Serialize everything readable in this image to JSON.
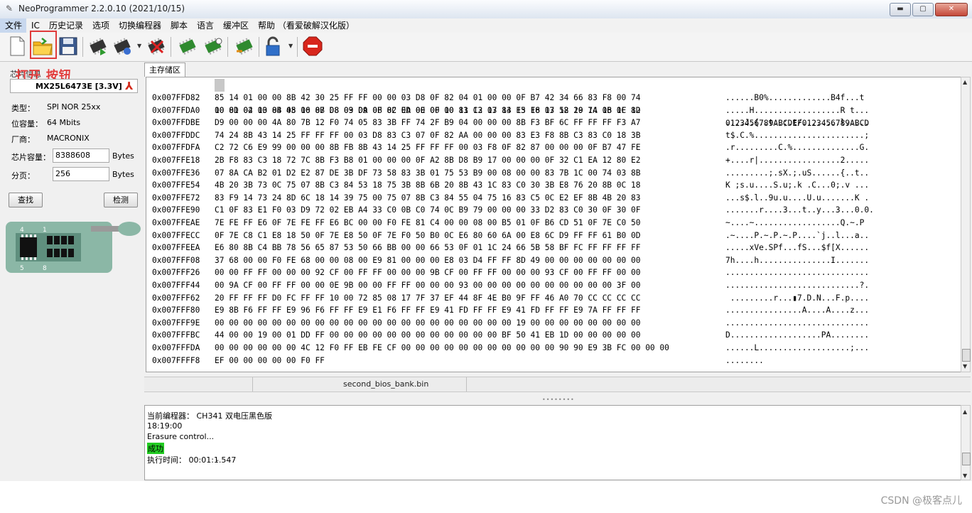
{
  "window": {
    "title": "NeoProgrammer 2.2.0.10 (2021/10/15)"
  },
  "menu": [
    "文件",
    "IC",
    "历史记录",
    "选项",
    "切换编程器",
    "脚本",
    "语言",
    "缓冲区",
    "帮助 （看爱破解汉化版）"
  ],
  "toolbar": {
    "icons": [
      "new-file-icon",
      "open-folder-icon",
      "save-disk-icon",
      "read-chip-icon",
      "write-chip-icon",
      "erase-chip-icon",
      "verify-chip-icon",
      "blank-check-icon",
      "auto-chip-icon",
      "lock-icon",
      "stop-icon"
    ]
  },
  "annotation": "打开 按钮",
  "chip_info": {
    "group_label": "芯片信息",
    "chip_name": "MX25L6473E [3.3V]",
    "type_label": "类型：",
    "type_value": "SPI NOR 25xx",
    "bits_label": "位容量：",
    "bits_value": "64 Mbits",
    "vendor_label": "厂商：",
    "vendor_value": "MACRONIX",
    "capacity_label": "芯片容量：",
    "capacity_value": "8388608",
    "capacity_unit": "Bytes",
    "page_label": "分页：",
    "page_value": "256",
    "page_unit": "Bytes",
    "find_button": "查找",
    "detect_button": "检测",
    "pin_labels": [
      "4",
      "1",
      "5",
      "8"
    ]
  },
  "tab": {
    "label": "主存储区"
  },
  "hex": {
    "header": "00 01 02 03 04 05 06 07 08 09 0A 0B 0C 0D 0E 0F 10 11 12 13 14 15 16 17 18 19 1A 1B 1C 1D",
    "ascii_header": "0123456789ABCDEF0123456789ABCD",
    "rows": [
      {
        "addr": "0x007FFD82",
        "bytes": "85 14 01 00 00 8B 42 30 25 FF FF 00 00 03 D8 0F 82 04 01 00 00 0F B7 42 34 66 83 F8 00 74",
        "ascii": "......B0%.............B4f...t"
      },
      {
        "addr": "0x007FFDA0",
        "bytes": "10 8D 04 10 8B 48 10 8B D8 03 D9 0F 82 EA 00 00 00 83 C3 07 83 E3 F8 03 52 20 74 06 0F 82",
        "ascii": ".....H..................R t..."
      },
      {
        "addr": "0x007FFDBE",
        "bytes": "D9 00 00 00 4A 80 7B 12 F0 74 05 83 3B FF 74 2F B9 04 00 00 00 8B F3 BF 6C FF FF FF F3 A7",
        "ascii": "....J.{..t..;.t/........l....."
      },
      {
        "addr": "0x007FFDDC",
        "bytes": "74 24 8B 43 14 25 FF FF FF 00 03 D8 83 C3 07 0F 82 AA 00 00 00 83 E3 F8 8B C3 83 C0 18 3B",
        "ascii": "t$.C.%.......................;"
      },
      {
        "addr": "0x007FFDFA",
        "bytes": "C2 72 C6 E9 99 00 00 00 8B FB 8B 43 14 25 FF FF FF 00 03 F8 0F 82 87 00 00 00 0F B7 47 FE",
        "ascii": ".r.........C.%..............G."
      },
      {
        "addr": "0x007FFE18",
        "bytes": "2B F8 83 C3 18 72 7C 8B F3 B8 01 00 00 00 0F A2 8B D8 B9 17 00 00 00 0F 32 C1 EA 12 80 E2",
        "ascii": "+....r|.................2....."
      },
      {
        "addr": "0x007FFE36",
        "bytes": "07 8A CA B2 01 D2 E2 87 DE 3B DF 73 58 83 3B 01 75 53 B9 00 08 00 00 83 7B 1C 00 74 03 8B",
        "ascii": ".........;.sX.;.uS......{..t.."
      },
      {
        "addr": "0x007FFE54",
        "bytes": "4B 20 3B 73 0C 75 07 8B C3 84 53 18 75 3B 8B 6B 20 8B 43 1C 83 C0 30 3B E8 76 20 8B 0C 18",
        "ascii": "K ;s.u....S.u;.k .C...0;.v ..."
      },
      {
        "addr": "0x007FFE72",
        "bytes": "83 F9 14 73 24 8D 6C 18 14 39 75 00 75 07 8B C3 84 55 04 75 16 83 C5 0C E2 EF 8B 4B 20 83",
        "ascii": "...s$.l..9u.u....U.u.......K ."
      },
      {
        "addr": "0x007FFE90",
        "bytes": "C1 0F 83 E1 F0 03 D9 72 02 EB A4 33 C0 0B C0 74 0C B9 79 00 00 00 33 D2 83 C0 30 0F 30 0F",
        "ascii": ".......r....3...t..y...3...0.0."
      },
      {
        "addr": "0x007FFEAE",
        "bytes": "7E FE FF E6 0F 7E FE FF E6 BC 00 00 F0 FE 81 C4 00 00 08 00 B5 01 0F B6 CD 51 0F 7E C0 50",
        "ascii": "~....~..................Q.~.P"
      },
      {
        "addr": "0x007FFECC",
        "bytes": "0F 7E C8 C1 E8 18 50 0F 7E E8 50 0F 7E F0 50 B0 0C E6 80 60 6A 00 E8 6C D9 FF FF 61 B0 0D",
        "ascii": ".~....P.~.P.~.P....`j..l...a.."
      },
      {
        "addr": "0x007FFEEA",
        "bytes": "E6 80 8B C4 BB 78 56 65 87 53 50 66 BB 00 00 66 53 0F 01 1C 24 66 5B 58 BF FC FF FF FF FF",
        "ascii": ".....xVe.SPf...fS...$f[X......"
      },
      {
        "addr": "0x007FFF08",
        "bytes": "37 68 00 00 F0 FE 68 00 00 08 00 E9 81 00 00 00 E8 03 D4 FF FF 8D 49 00 00 00 00 00 00 00",
        "ascii": "7h....h...............I......."
      },
      {
        "addr": "0x007FFF26",
        "bytes": "00 00 FF FF 00 00 00 92 CF 00 FF FF 00 00 00 9B CF 00 FF FF 00 00 00 93 CF 00 FF FF 00 00",
        "ascii": ".............................."
      },
      {
        "addr": "0x007FFF44",
        "bytes": "00 9A CF 00 FF FF 00 00 0E 9B 00 00 FF FF 00 00 00 93 00 00 00 00 00 00 00 00 00 00 3F 00",
        "ascii": "............................?."
      },
      {
        "addr": "0x007FFF62",
        "bytes": "20 FF FF FF D0 FC FF FF 10 00 72 85 08 17 7F 37 EF 44 8F 4E B0 9F FF 46 A0 70 CC CC CC CC",
        "ascii": " .........r...▮7.D.N...F.p...."
      },
      {
        "addr": "0x007FFF80",
        "bytes": "E9 8B F6 FF FF E9 96 F6 FF FF E9 E1 F6 FF FF E9 41 FD FF FF E9 41 FD FF FF E9 7A FF FF FF",
        "ascii": "................A....A....z..."
      },
      {
        "addr": "0x007FFF9E",
        "bytes": "00 00 00 00 00 00 00 00 00 00 00 00 00 00 00 00 00 00 00 00 00 19 00 00 00 00 00 00 00 00",
        "ascii": ".............................."
      },
      {
        "addr": "0x007FFFBC",
        "bytes": "44 00 00 19 00 01 DD FF 00 00 00 00 00 00 00 00 00 00 00 00 BF 50 41 EB 1D 00 00 00 00 00",
        "ascii": "D...................PA........"
      },
      {
        "addr": "0x007FFFDA",
        "bytes": "00 00 00 00 00 00 4C 12 F0 FF EB FE CF 00 00 00 00 00 00 00 00 00 00 00 90 90 E9 3B FC 00 00 00",
        "ascii": "......L...................;..."
      },
      {
        "addr": "0x007FFFF8",
        "bytes": "EF 00 00 00 00 00 F0 FF",
        "ascii": "........"
      }
    ]
  },
  "status": {
    "filename": "second_bios_bank.bin"
  },
  "log": {
    "lines": [
      "当前编程器： CH341 双电压黑色版",
      "18:19:00",
      "Erasure control...",
      "成功",
      "执行时间：  00:01:1̵.547"
    ]
  },
  "watermark": "CSDN @极客点儿",
  "colors": {
    "accent": "#e03a3a",
    "success": "#22cc22",
    "title_bg": "#dde5f0"
  }
}
